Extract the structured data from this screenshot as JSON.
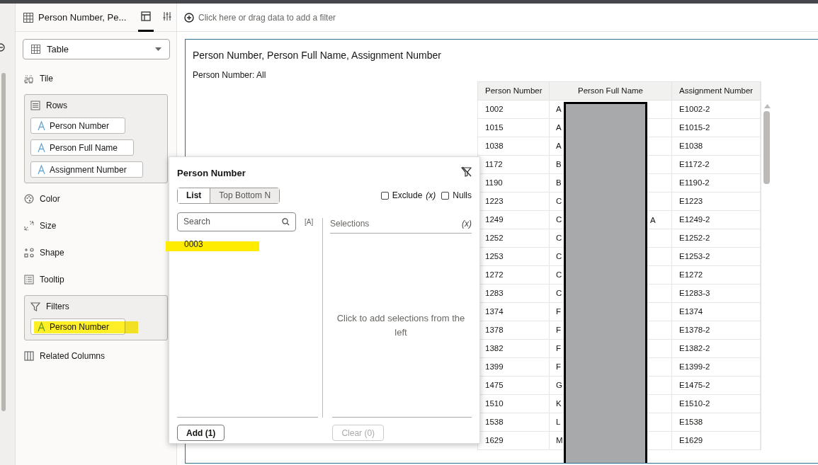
{
  "panel_header": {
    "title": "Person Number, Pe...",
    "tabs": [
      {
        "kind": "layout",
        "selected": true
      },
      {
        "kind": "properties",
        "selected": false
      }
    ]
  },
  "filter_bar": {
    "placeholder": "Click here or drag data to add a filter"
  },
  "sidebar": {
    "viz_type": "Table",
    "sections": [
      {
        "kind": "item",
        "label": "Tile"
      },
      {
        "kind": "group",
        "label": "Rows",
        "pills": [
          {
            "label": "Person Number",
            "highlighted": false
          },
          {
            "label": "Person Full Name",
            "highlighted": false
          },
          {
            "label": "Assignment Number",
            "highlighted": false
          }
        ]
      },
      {
        "kind": "item",
        "label": "Color"
      },
      {
        "kind": "item",
        "label": "Size"
      },
      {
        "kind": "item",
        "label": "Shape"
      },
      {
        "kind": "item",
        "label": "Tooltip"
      },
      {
        "kind": "group",
        "label": "Filters",
        "pills": [
          {
            "label": "Person Number",
            "highlighted": true
          }
        ]
      },
      {
        "kind": "item",
        "label": "Related Columns"
      }
    ]
  },
  "visualization": {
    "title": "Person Number, Person Full Name, Assignment Number",
    "filter_label": "Person Number:",
    "filter_value": "All",
    "table": {
      "columns": [
        "Person Number",
        "Person Full Name",
        "Assignment Number"
      ],
      "rows": [
        {
          "number": "1002",
          "name": "A",
          "assignment": "E1002-2"
        },
        {
          "number": "1015",
          "name": "A",
          "assignment": "E1015-2"
        },
        {
          "number": "1038",
          "name": "A",
          "assignment": "E1038"
        },
        {
          "number": "1172",
          "name": "B",
          "assignment": "E1172-2"
        },
        {
          "number": "1190",
          "name": "B",
          "assignment": "E1190-2"
        },
        {
          "number": "1223",
          "name": "C",
          "assignment": "E1223"
        },
        {
          "number": "1249",
          "name": "C",
          "name_tail": "A",
          "assignment": "E1249-2"
        },
        {
          "number": "1252",
          "name": "C",
          "assignment": "E1252-2"
        },
        {
          "number": "1253",
          "name": "C",
          "assignment": "E1253-2"
        },
        {
          "number": "1272",
          "name": "C",
          "assignment": "E1272"
        },
        {
          "number": "1283",
          "name": "C",
          "assignment": "E1283-3"
        },
        {
          "number": "1374",
          "name": "F",
          "assignment": "E1374"
        },
        {
          "number": "1378",
          "name": "F",
          "assignment": "E1378-2"
        },
        {
          "number": "1382",
          "name": "F",
          "assignment": "E1382-2"
        },
        {
          "number": "1399",
          "name": "F",
          "assignment": "E1399-2"
        },
        {
          "number": "1475",
          "name": "G",
          "assignment": "E1475-2"
        },
        {
          "number": "1510",
          "name": "K",
          "assignment": "E1510-2"
        },
        {
          "number": "1538",
          "name": "L",
          "assignment": "E1538"
        },
        {
          "number": "1629",
          "name": "M",
          "assignment": "E1629"
        }
      ]
    }
  },
  "filter_popup": {
    "title": "Person Number",
    "tabs": [
      {
        "label": "List",
        "selected": true
      },
      {
        "label": "Top Bottom N",
        "selected": false
      }
    ],
    "options": [
      {
        "label": "Exclude",
        "suffix": "(x)",
        "checked": false
      },
      {
        "label": "Nulls",
        "checked": false
      }
    ],
    "search": {
      "placeholder": "Search"
    },
    "case_toggle": "[A]",
    "values": [
      {
        "label": "0003",
        "highlighted": true
      }
    ],
    "selections_label": "Selections",
    "selections_expr": "(x)",
    "empty_text": "Click to add selections from the left",
    "add_button": "Add (1)",
    "clear_button": "Clear (0)",
    "clear_disabled": true
  }
}
